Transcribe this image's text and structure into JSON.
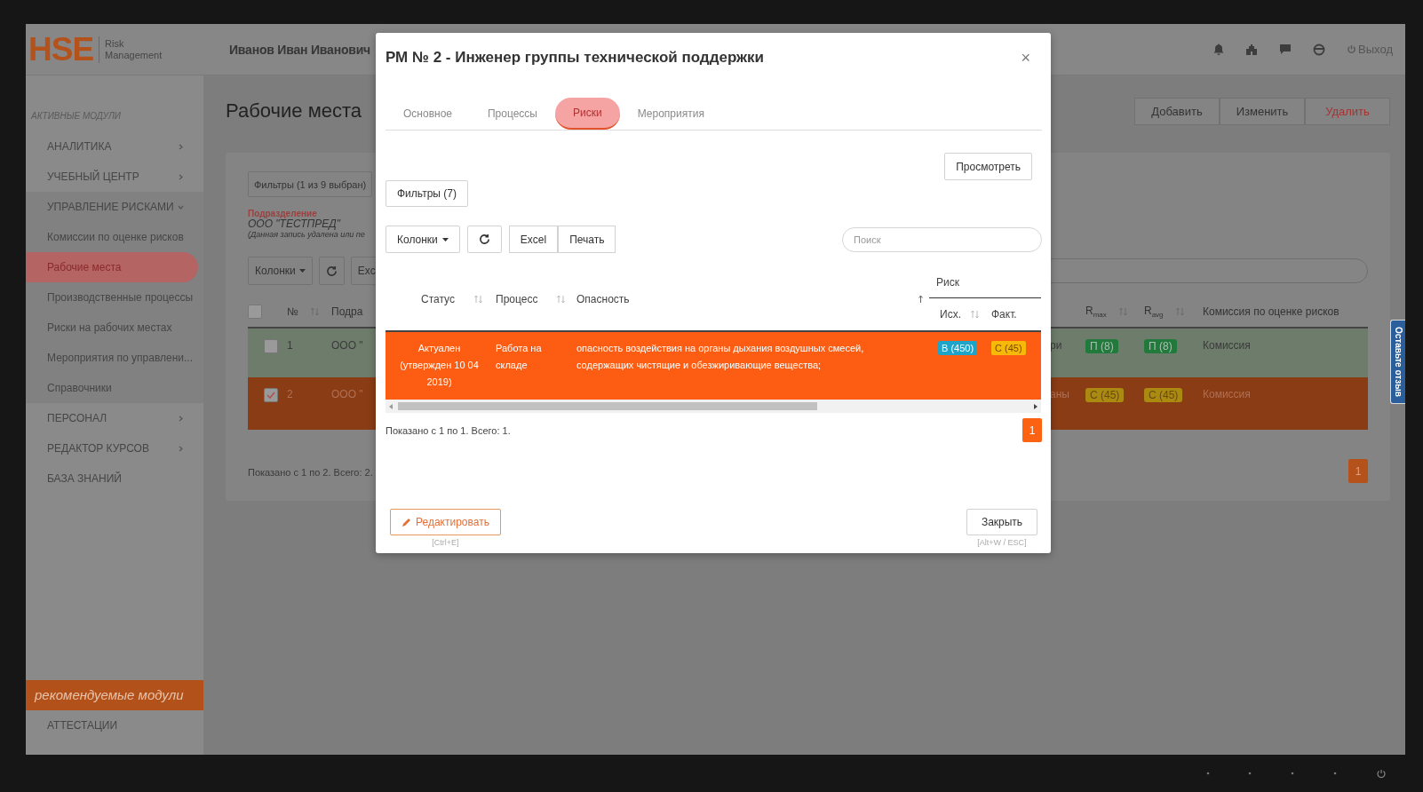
{
  "header": {
    "logo_mark": "HSE",
    "logo_caption": [
      "Risk",
      "Management"
    ],
    "user": "Иванов Иван Иванович",
    "logout": "Выход"
  },
  "sidebar": {
    "section_title": "АКТИВНЫЕ МОДУЛИ",
    "items": [
      {
        "label": "АНАЛИТИКА",
        "kind": "group",
        "expanded": false
      },
      {
        "label": "УЧЕБНЫЙ ЦЕНТР",
        "kind": "group",
        "expanded": false
      },
      {
        "label": "УПРАВЛЕНИЕ РИСКАМИ",
        "kind": "group",
        "expanded": true,
        "children": [
          {
            "label": "Комиссии по оценке рисков",
            "selected": false
          },
          {
            "label": "Рабочие места",
            "selected": true
          },
          {
            "label": "Производственные процессы",
            "selected": false
          },
          {
            "label": "Риски на рабочих местах",
            "selected": false
          },
          {
            "label": "Мероприятия по управлени...",
            "selected": false
          },
          {
            "label": "Справочники",
            "selected": false
          }
        ]
      },
      {
        "label": "ПЕРСОНАЛ",
        "kind": "group",
        "expanded": false
      },
      {
        "label": "РЕДАКТОР КУРСОВ",
        "kind": "group",
        "expanded": false
      },
      {
        "label": "БАЗА ЗНАНИЙ",
        "kind": "link"
      }
    ],
    "recommended_title": "рекомендуемые модули",
    "recommended_items": [
      "АТТЕСТАЦИИ"
    ]
  },
  "page": {
    "title": "Рабочие места",
    "actions": [
      {
        "label": "Добавить",
        "kind": "normal"
      },
      {
        "label": "Изменить",
        "kind": "normal"
      },
      {
        "label": "Удалить",
        "kind": "danger"
      }
    ],
    "filters_button": "Фильтры (1 из 9 выбран)",
    "department": {
      "label": "Подразделение",
      "value": "ООО \"ТЕСТПРЕД\"",
      "note": "(Данная запись удалена или пе"
    },
    "columns_button": "Колонки",
    "export_button": "Exc",
    "table": {
      "select_all_checked": false,
      "columns": [
        "№",
        "Подра",
        "R$_{max}$",
        "R$_{avg}$",
        "Комиссия по оценке рисков"
      ],
      "rows": [
        {
          "checked": false,
          "color": "#6e7d6b",
          "number": "1",
          "column_3": "ООО \"",
          "column_4": "ри",
          "r_max": {
            "label": "П (8)",
            "color": "#217a3c"
          },
          "r_avg": {
            "label": "П (8)",
            "color": "#217a3c"
          },
          "commission": "Комиссия"
        },
        {
          "checked": true,
          "color": "#8a3c15",
          "number": "2",
          "column_3": "ООО \"",
          "column_4": "аны",
          "r_max": {
            "label": "С (45)",
            "color": "#ab8a12"
          },
          "r_avg": {
            "label": "С (45)",
            "color": "#ab8a12"
          },
          "commission": "Комиссия"
        }
      ]
    },
    "info": "Показано с 1 по 2. Всего: 2.",
    "pagination": [
      {
        "label": "1",
        "selected": true
      }
    ]
  },
  "feedback_tab": "Оставьте отзыв",
  "modal": {
    "title": "РМ № 2 - Инженер группы технической поддержки",
    "close_symbol": "×",
    "tabs": [
      {
        "label": "Основное",
        "selected": false
      },
      {
        "label": "Процессы",
        "selected": false
      },
      {
        "label": "Риски",
        "selected": true
      },
      {
        "label": "Мероприятия",
        "selected": false
      }
    ],
    "view_button": "Просмотреть",
    "filters_button": "Фильтры (7)",
    "columns_button": "Колонки",
    "export_buttons": [
      "Excel",
      "Печать"
    ],
    "search": {
      "placeholder": "Поиск"
    },
    "table": {
      "columns": [
        "Статус",
        "Процесс",
        "Опасность"
      ],
      "group_header": "Риск",
      "subcolumns": [
        "Исх.",
        "Факт."
      ],
      "rows": [
        {
          "status": "Актуален (утвержден 10 04 2019)",
          "process": "Работа на складе",
          "hazard": "опасность воздействия на органы дыхания воздушных смесей, содержащих чистящие и обезжиривающие вещества;",
          "initial": {
            "label": "В (450)",
            "color": "#1ea3c9"
          },
          "actual": {
            "label": "С (45)",
            "color": "#f6b90a"
          }
        }
      ]
    },
    "info": "Показано с 1 по 1. Всего: 1.",
    "pagination": [
      {
        "label": "1",
        "selected": true
      }
    ],
    "edit_button": {
      "label": "Редактировать",
      "shortcut": "[Ctrl+E]"
    },
    "close_button": {
      "label": "Закрыть",
      "shortcut": "[Alt+W / ESC]"
    }
  }
}
